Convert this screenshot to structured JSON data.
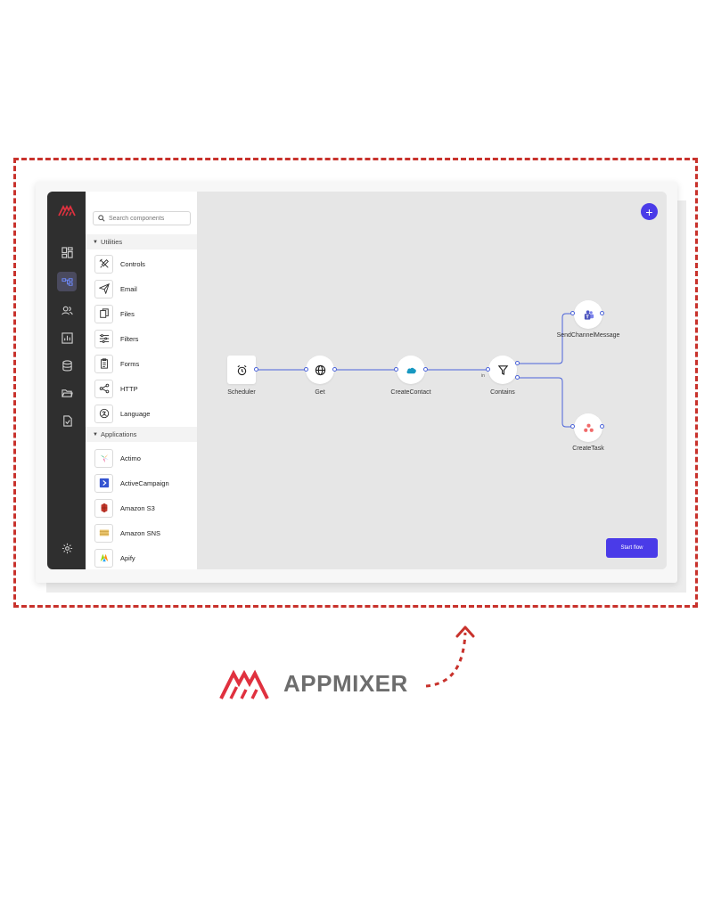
{
  "search": {
    "placeholder": "Search components"
  },
  "sections": {
    "utilities": "Utilities",
    "applications": "Applications"
  },
  "utilities": [
    {
      "label": "Controls",
      "icon": "controls-icon"
    },
    {
      "label": "Email",
      "icon": "email-icon"
    },
    {
      "label": "Files",
      "icon": "files-icon"
    },
    {
      "label": "Filters",
      "icon": "filters-icon"
    },
    {
      "label": "Forms",
      "icon": "forms-icon"
    },
    {
      "label": "HTTP",
      "icon": "http-icon"
    },
    {
      "label": "Language",
      "icon": "language-icon"
    }
  ],
  "applications": [
    {
      "label": "Actimo",
      "icon": "actimo-icon"
    },
    {
      "label": "ActiveCampaign",
      "icon": "activecampaign-icon"
    },
    {
      "label": "Amazon S3",
      "icon": "amazon-s3-icon"
    },
    {
      "label": "Amazon SNS",
      "icon": "amazon-sns-icon"
    },
    {
      "label": "Apify",
      "icon": "apify-icon"
    }
  ],
  "flow": {
    "nodes": [
      {
        "label": "Scheduler",
        "icon": "alarm-clock-icon"
      },
      {
        "label": "Get",
        "icon": "globe-icon"
      },
      {
        "label": "CreateContact",
        "icon": "salesforce-cloud-icon"
      },
      {
        "label": "Contains",
        "icon": "filter-funnel-icon"
      },
      {
        "label": "SendChannelMessage",
        "icon": "teams-icon"
      },
      {
        "label": "CreateTask",
        "icon": "asana-icon"
      }
    ],
    "in_port_label": "in"
  },
  "buttons": {
    "add": "+",
    "start_flow": "Start flow"
  },
  "brand": {
    "name": "APPMIXER"
  },
  "colors": {
    "accent": "#4a3be8",
    "brand_red": "#e0313f",
    "rail": "#2f2f2f",
    "frame_dash": "#c8322c"
  }
}
